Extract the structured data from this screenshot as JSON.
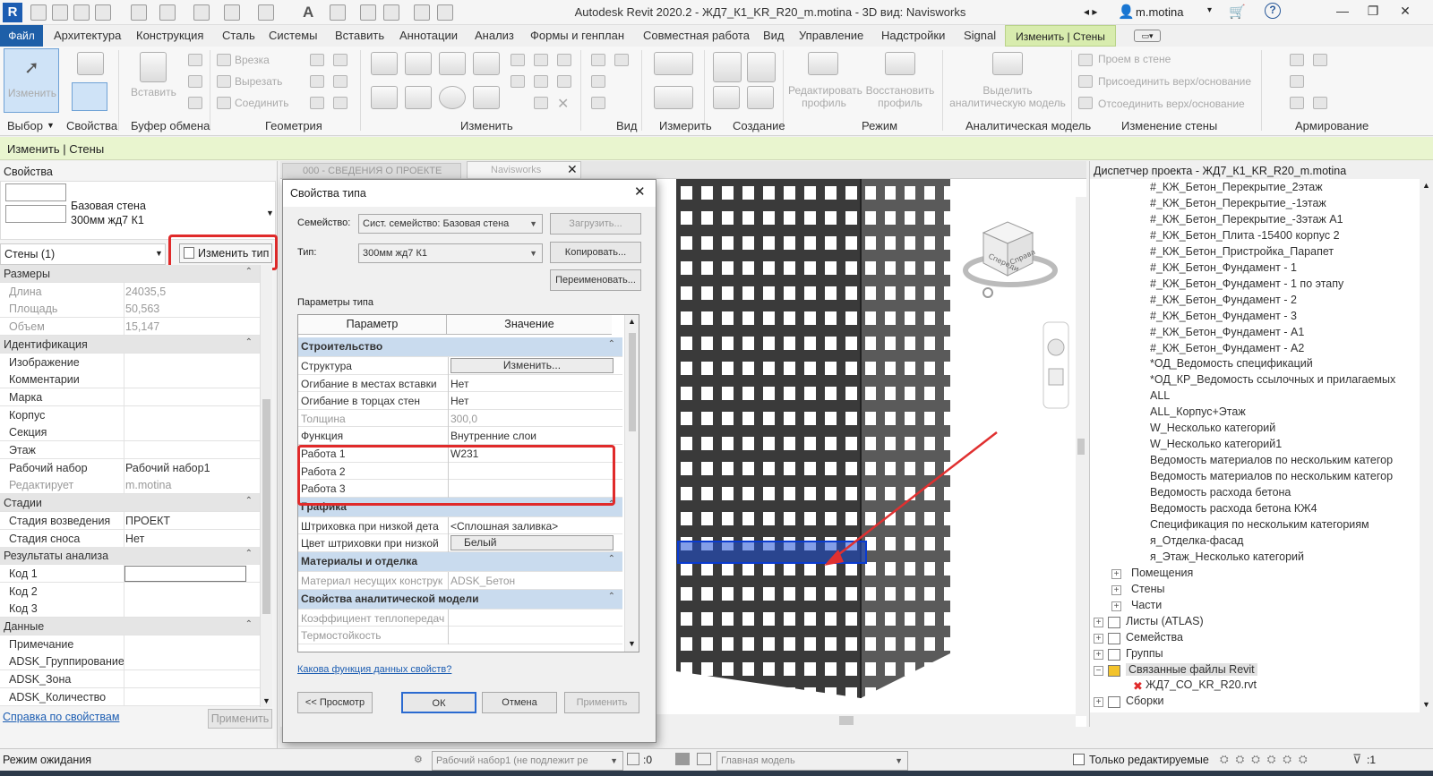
{
  "titlebar": {
    "title": "Autodesk Revit 2020.2 - ЖД7_К1_KR_R20_m.motina - 3D вид: Navisworks",
    "user": "m.motina",
    "help_icon": "question-icon"
  },
  "menu": {
    "tabs": [
      "Файл",
      "Архитектура",
      "Конструкция",
      "Сталь",
      "Системы",
      "Вставить",
      "Аннотации",
      "Анализ",
      "Формы и генплан",
      "Совместная работа",
      "Вид",
      "Управление",
      "Надстройки",
      "Signal",
      "Изменить | Стены"
    ]
  },
  "ribbon": {
    "select_label": "Изменить",
    "paste_label": "Вставить",
    "cut_label": "Врезка",
    "cut2_label": "Вырезать",
    "join_label": "Соединить",
    "edit_profile": "Редактировать профиль",
    "restore_profile": "Восстановить профиль",
    "analytical": "Выделить аналитическую модель",
    "opening": "Проем в стене",
    "attach": "Присоединить верх/основание",
    "detach": "Отсоединить верх/основание",
    "panels": [
      "Выбор",
      "Свойства",
      "Буфер обмена",
      "Геометрия",
      "Изменить",
      "Вид",
      "Измерить",
      "Создание",
      "Режим",
      "Аналитическая модель",
      "Изменение стены",
      "Армирование"
    ]
  },
  "context_bar": {
    "label": "Изменить | Стены"
  },
  "properties": {
    "header": "Свойства",
    "type_name_1": "Базовая стена",
    "type_name_2": "300мм жд7 К1",
    "selector": "Стены (1)",
    "edit_type_button": "Изменить тип",
    "rows": [
      {
        "k": "Размеры",
        "v": "",
        "group": true
      },
      {
        "k": "Длина",
        "v": "24035,5",
        "gray": true
      },
      {
        "k": "Площадь",
        "v": "50,563",
        "gray": true
      },
      {
        "k": "Объем",
        "v": "15,147",
        "gray": true
      },
      {
        "k": "Идентификация",
        "v": "",
        "group": true
      },
      {
        "k": "Изображение",
        "v": ""
      },
      {
        "k": "Комментарии",
        "v": ""
      },
      {
        "k": "Марка",
        "v": ""
      },
      {
        "k": "Корпус",
        "v": ""
      },
      {
        "k": "Секция",
        "v": ""
      },
      {
        "k": "Этаж",
        "v": ""
      },
      {
        "k": "Рабочий набор",
        "v": "Рабочий набор1"
      },
      {
        "k": "Редактирует",
        "v": "m.motina",
        "gray": true
      },
      {
        "k": "Стадии",
        "v": "",
        "group": true
      },
      {
        "k": "Стадия возведения",
        "v": "ПРОЕКТ"
      },
      {
        "k": "Стадия сноса",
        "v": "Нет"
      },
      {
        "k": "Результаты анализа",
        "v": "",
        "group": true
      },
      {
        "k": "Код 1",
        "v": ""
      },
      {
        "k": "Код 2",
        "v": ""
      },
      {
        "k": "Код 3",
        "v": ""
      },
      {
        "k": "Данные",
        "v": "",
        "group": true
      },
      {
        "k": "Примечание",
        "v": ""
      },
      {
        "k": "ADSK_Группирование",
        "v": ""
      },
      {
        "k": "ADSK_Зона",
        "v": ""
      },
      {
        "k": "ADSK_Количество",
        "v": ""
      }
    ],
    "help_link": "Справка по свойствам",
    "apply_button": "Применить"
  },
  "view_tabs": [
    "000 - СВЕДЕНИЯ О ПРОЕКТЕ",
    "Navisworks"
  ],
  "dialog": {
    "title": "Свойства типа",
    "family_label": "Семейство:",
    "family_value": "Сист. семейство: Базовая стена",
    "type_label": "Тип:",
    "type_value": "300мм жд7 К1",
    "load_button": "Загрузить...",
    "copy_button": "Копировать...",
    "rename_button": "Переименовать...",
    "params_label": "Параметры типа",
    "col_param": "Параметр",
    "col_value": "Значение",
    "rows": [
      {
        "k": "Строительство",
        "v": "",
        "group": true
      },
      {
        "k": "Структура",
        "v": "Изменить...",
        "button": true
      },
      {
        "k": "Огибание в местах вставки",
        "v": "Нет"
      },
      {
        "k": "Огибание в торцах стен",
        "v": "Нет"
      },
      {
        "k": "Толщина",
        "v": "300,0",
        "gray": true
      },
      {
        "k": "Функция",
        "v": "Внутренние слои"
      },
      {
        "k": "Работа 1",
        "v": "W231"
      },
      {
        "k": "Работа 2",
        "v": ""
      },
      {
        "k": "Работа 3",
        "v": ""
      },
      {
        "k": "Графика",
        "v": "",
        "group": true
      },
      {
        "k": "Штриховка при низкой дета",
        "v": "<Сплошная заливка>"
      },
      {
        "k": "Цвет штриховки при низкой",
        "v": "Белый",
        "button": true
      },
      {
        "k": "Материалы и отделка",
        "v": "",
        "group": true
      },
      {
        "k": "Материал несущих конструк",
        "v": "ADSK_Бетон",
        "gray": true
      },
      {
        "k": "Свойства аналитической модели",
        "v": "",
        "group": true
      },
      {
        "k": "Коэффициент теплопередач",
        "v": "",
        "gray": true
      },
      {
        "k": "Термостойкость",
        "v": "",
        "gray": true
      }
    ],
    "help_link": "Какова функция данных свойств?",
    "preview_button": "<< Просмотр",
    "ok_button": "ОК",
    "cancel_button": "Отмена",
    "apply_button": "Применить"
  },
  "viewcube": {
    "front": "Спереди",
    "right": "Справа"
  },
  "browser": {
    "title": "Диспетчер проекта - ЖД7_К1_KR_R20_m.motina",
    "items": [
      "#_КЖ_Бетон_Перекрытие_2этаж",
      "#_КЖ_Бетон_Перекрытие_-1этаж",
      "#_КЖ_Бетон_Перекрытие_-3этаж А1",
      "#_КЖ_Бетон_Плита -15400 корпус 2",
      "#_КЖ_Бетон_Пристройка_Парапет",
      "#_КЖ_Бетон_Фундамент - 1",
      "#_КЖ_Бетон_Фундамент - 1 по этапу",
      "#_КЖ_Бетон_Фундамент - 2",
      "#_КЖ_Бетон_Фундамент - 3",
      "#_КЖ_Бетон_Фундамент - А1",
      "#_КЖ_Бетон_Фундамент - А2",
      "*ОД_Ведомость спецификаций",
      "*ОД_КР_Ведомость ссылочных и прилагаемых",
      "ALL",
      "ALL_Корпус+Этаж",
      "W_Несколько категорий",
      "W_Несколько категорий1",
      "Ведомость материалов по нескольким категор",
      "Ведомость материалов по нескольким категор",
      "Ведомость расхода бетона",
      "Ведомость расхода бетона КЖ4",
      "Спецификация по нескольким категориям",
      "я_Отделка-фасад",
      "я_Этаж_Несколько категорий"
    ],
    "sub_nodes": [
      "Помещения",
      "Стены",
      "Части"
    ],
    "top_nodes": [
      "Листы (ATLAS)",
      "Семейства",
      "Группы",
      "Связанные файлы Revit"
    ],
    "linked_file": "ЖД7_СО_KR_R20.rvt",
    "last_node": "Сборки"
  },
  "status": {
    "mode": "Режим ожидания",
    "workset": "Рабочий набор1 (не подлежит ре",
    "count": ":0",
    "model": "Главная модель",
    "editable_only": "Только редактируемые",
    "filter_count": ":1"
  },
  "colors": {
    "accent_blue": "#1e5fa8",
    "context_green": "#d8ecae",
    "highlight_red": "#e02a2a",
    "group_blue": "#c9dbee"
  }
}
